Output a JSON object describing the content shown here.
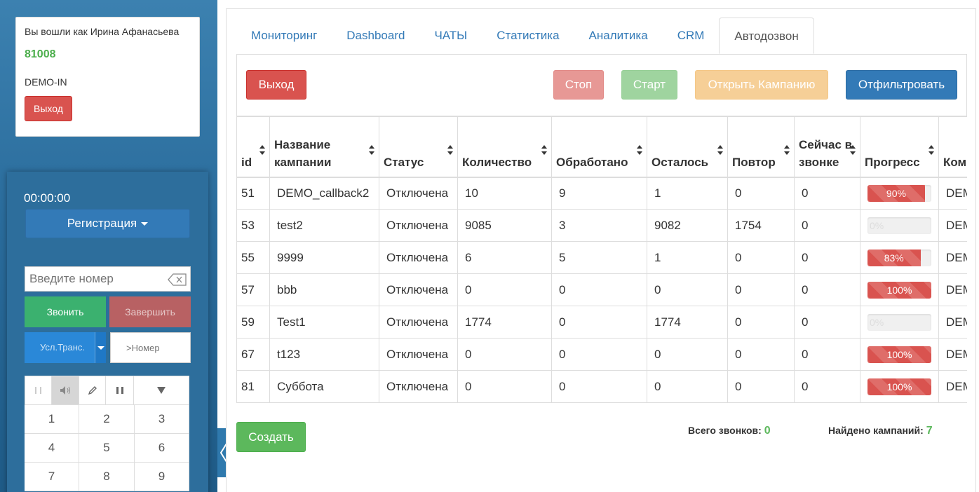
{
  "sidebar": {
    "user": {
      "logged_in_as": "Вы вошли как Ирина Афанасьева",
      "extension": "81008",
      "queue": "DEMO-IN",
      "logout_label": "Выход"
    },
    "phone": {
      "timer": "00:00:00",
      "register_label": "Регистрация",
      "number_placeholder": "Введите номер",
      "call_label": "Звонить",
      "end_label": "Завершить",
      "transfer_label": "Усл.Транс.",
      "transfer_placeholder": ">Номер",
      "keys": [
        "1",
        "2",
        "3",
        "4",
        "5",
        "6",
        "7",
        "8",
        "9"
      ]
    }
  },
  "tabs": [
    "Мониторинг",
    "Dashboard",
    "ЧАТЫ",
    "Статистика",
    "Аналитика",
    "CRM",
    "Автодозвон"
  ],
  "active_tab": "Автодозвон",
  "buttons": {
    "exit": "Выход",
    "stop": "Стоп",
    "start": "Старт",
    "open_campaign": "Открыть Кампанию",
    "filter": "Отфильтровать",
    "create": "Создать"
  },
  "table": {
    "headers": [
      "id",
      "Название кампании",
      "Статус",
      "Количество",
      "Обработано",
      "Осталось",
      "Повтор",
      "Сейчас в звонке",
      "Прогресс",
      "Ком"
    ],
    "rows": [
      {
        "id": "51",
        "name": "DEMO_callback2",
        "status": "Отключена",
        "count": "10",
        "processed": "9",
        "left": "1",
        "repeat": "0",
        "now": "0",
        "progress": 90,
        "progress_label": "90%",
        "comment": "DEM"
      },
      {
        "id": "53",
        "name": "test2",
        "status": "Отключена",
        "count": "9085",
        "processed": "3",
        "left": "9082",
        "repeat": "1754",
        "now": "0",
        "progress": 0,
        "progress_label": "0%",
        "comment": "DEM"
      },
      {
        "id": "55",
        "name": "9999",
        "status": "Отключена",
        "count": "6",
        "processed": "5",
        "left": "1",
        "repeat": "0",
        "now": "0",
        "progress": 83,
        "progress_label": "83%",
        "comment": "DEM"
      },
      {
        "id": "57",
        "name": "bbb",
        "status": "Отключена",
        "count": "0",
        "processed": "0",
        "left": "0",
        "repeat": "0",
        "now": "0",
        "progress": 100,
        "progress_label": "100%",
        "comment": "DEM"
      },
      {
        "id": "59",
        "name": "Test1",
        "status": "Отключена",
        "count": "1774",
        "processed": "0",
        "left": "1774",
        "repeat": "0",
        "now": "0",
        "progress": 0,
        "progress_label": "0%",
        "comment": "DEM"
      },
      {
        "id": "67",
        "name": "t123",
        "status": "Отключена",
        "count": "0",
        "processed": "0",
        "left": "0",
        "repeat": "0",
        "now": "0",
        "progress": 100,
        "progress_label": "100%",
        "comment": "DEM"
      },
      {
        "id": "81",
        "name": "Суббота",
        "status": "Отключена",
        "count": "0",
        "processed": "0",
        "left": "0",
        "repeat": "0",
        "now": "0",
        "progress": 100,
        "progress_label": "100%",
        "comment": "DEM"
      }
    ]
  },
  "footer": {
    "total_calls_label": "Всего звонков:",
    "total_calls": "0",
    "found_label": "Найдено кампаний:",
    "found": "7"
  }
}
